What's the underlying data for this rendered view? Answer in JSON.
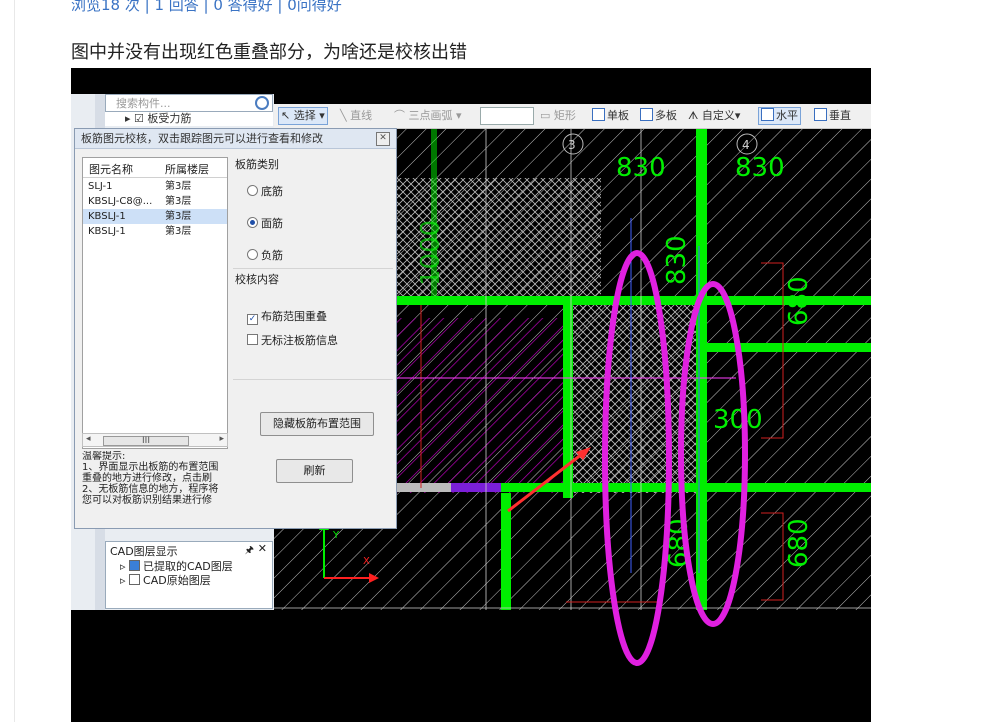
{
  "post": {
    "stats": "浏览18 次 | 1 回答 | 0 答得好 | 0问得好",
    "question": "图中并没有出现红色重叠部分，为啥还是校核出错"
  },
  "toolbar": {
    "select": "选择",
    "line": "直线",
    "arc": "三点画弧",
    "rect": "矩形",
    "single": "单板",
    "multi": "多板",
    "custom": "自定义",
    "horizontal": "水平",
    "vertical": "垂直"
  },
  "search": {
    "placeholder": "搜索构件..."
  },
  "tree": {
    "item": "板受力筋"
  },
  "dialog": {
    "title": "板筋图元校核，双击跟踪图元可以进行查看和修改",
    "close": "✕",
    "columns": [
      "图元名称",
      "所属楼层"
    ],
    "rows": [
      {
        "name": "SLJ-1",
        "floor": "第3层"
      },
      {
        "name": "KBSLJ-C8@...",
        "floor": "第3层"
      },
      {
        "name": "KBSLJ-1",
        "floor": "第3层"
      },
      {
        "name": "KBSLJ-1",
        "floor": "第3层"
      }
    ],
    "scroll_label": "III",
    "group_type": "板筋类别",
    "radio_bottom": "底筋",
    "radio_top": "面筋",
    "radio_neg": "负筋",
    "group_check": "校核内容",
    "check_overlap": "布筋范围重叠",
    "check_nolabel": "无标注板筋信息",
    "hide_btn": "隐藏板筋布置范围",
    "refresh_btn": "刷新",
    "tips_title": "温馨提示:",
    "tips_line1": "1、界面显示出板筋的布置范围",
    "tips_line2": "重叠的地方进行修改，点击刷",
    "tips_line3": "2、无板筋信息的地方，程序将",
    "tips_line4": "您可以对板筋识别结果进行修"
  },
  "cad_panel": {
    "title": "CAD图层显示",
    "pin": "🖈",
    "close": "✕",
    "item1": "已提取的CAD图层",
    "item2": "CAD原始图层"
  },
  "drawing": {
    "dim_830_a": "830",
    "dim_830_b": "830",
    "dim_830_c": "830",
    "dim_1000": "1000",
    "dim_680_a": "680",
    "dim_680_b": "680",
    "dim_680_c": "680",
    "dim_300": "300",
    "axis_3": "3",
    "axis_4": "4",
    "ucs_y": "Y",
    "ucs_x": "X"
  },
  "colors": {
    "beam_green": "#00ee00",
    "highlight_magenta": "#e020e0",
    "link_blue": "#3a73c4"
  }
}
